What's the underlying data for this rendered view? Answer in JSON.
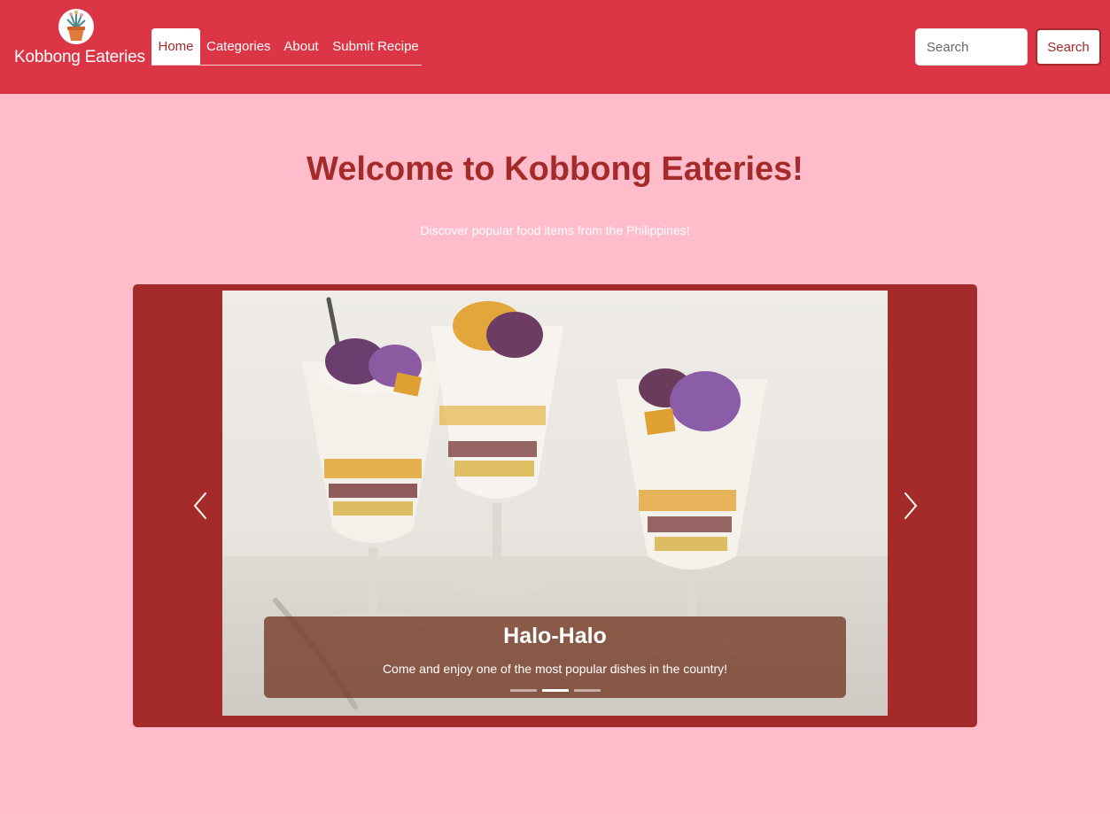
{
  "navbar": {
    "brand_name": "Kobbong Eateries",
    "logo_icon": "potted-plant-icon",
    "brand_color": "#dc3545",
    "items": [
      {
        "label": "Home",
        "active": true
      },
      {
        "label": "Categories",
        "active": false
      },
      {
        "label": "About",
        "active": false
      },
      {
        "label": "Submit Recipe",
        "active": false
      }
    ],
    "search": {
      "placeholder": "Search",
      "button_label": "Search"
    }
  },
  "hero": {
    "title": "Welcome to Kobbong Eateries!",
    "subtitle": "Discover popular food items from the Philippines!",
    "title_color": "#a52a2a",
    "background_color": "#ffbccb"
  },
  "carousel": {
    "frame_color": "#a52a2a",
    "prev_icon": "chevron-left-icon",
    "next_icon": "chevron-right-icon",
    "active_slide": 2,
    "slide_count": 3,
    "slide": {
      "image": "halo-halo-dessert-glasses",
      "title": "Halo-Halo",
      "text": "Come and enjoy one of the most popular dishes in the country!"
    }
  }
}
